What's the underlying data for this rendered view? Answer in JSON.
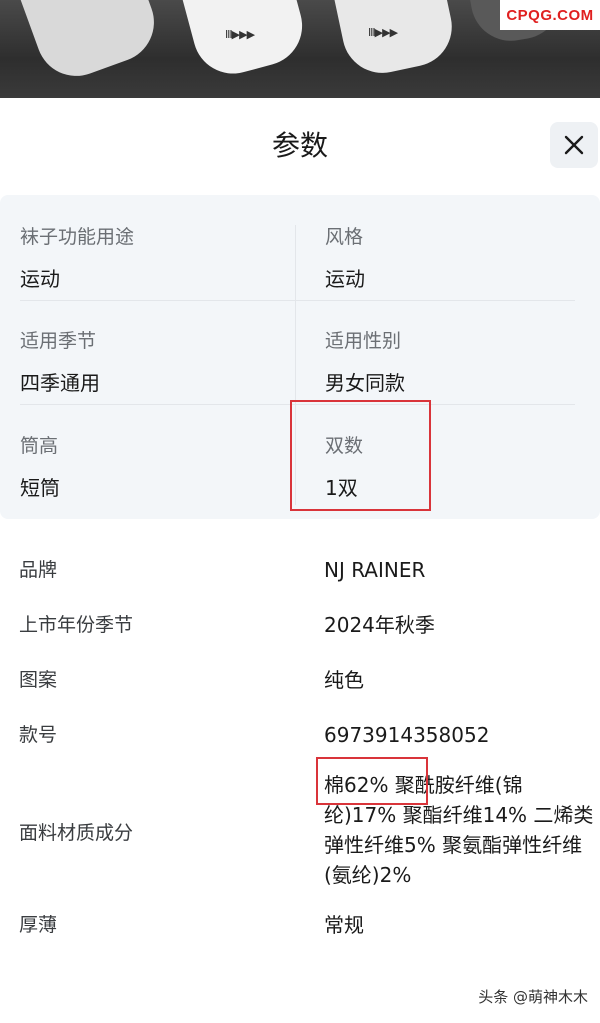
{
  "header": {
    "watermark_top": "CPQG.COM",
    "sock_marks": [
      "ⅡI▶▶▶",
      "ⅡI▶▶▶"
    ]
  },
  "sheet": {
    "title": "参数",
    "close_icon": "close-icon"
  },
  "grid": [
    {
      "label": "袜子功能用途",
      "value": "运动"
    },
    {
      "label": "风格",
      "value": "运动"
    },
    {
      "label": "适用季节",
      "value": "四季通用"
    },
    {
      "label": "适用性别",
      "value": "男女同款"
    },
    {
      "label": "筒高",
      "value": "短筒"
    },
    {
      "label": "双数",
      "value": "1双"
    }
  ],
  "list": [
    {
      "key": "品牌",
      "value": "NJ RAINER"
    },
    {
      "key": "上市年份季节",
      "value": "2024年秋季"
    },
    {
      "key": "图案",
      "value": "纯色"
    },
    {
      "key": "款号",
      "value": "6973914358052"
    },
    {
      "key": "面料材质成分",
      "value": "棉62% 聚酰胺纤维(锦纶)17% 聚酯纤维14% 二烯类弹性纤维5% 聚氨酯弹性纤维(氨纶)2%"
    },
    {
      "key": "厚薄",
      "value": "常规"
    }
  ],
  "annotation_color": "#d9343a",
  "watermark_bottom": "头条 @萌神木木"
}
